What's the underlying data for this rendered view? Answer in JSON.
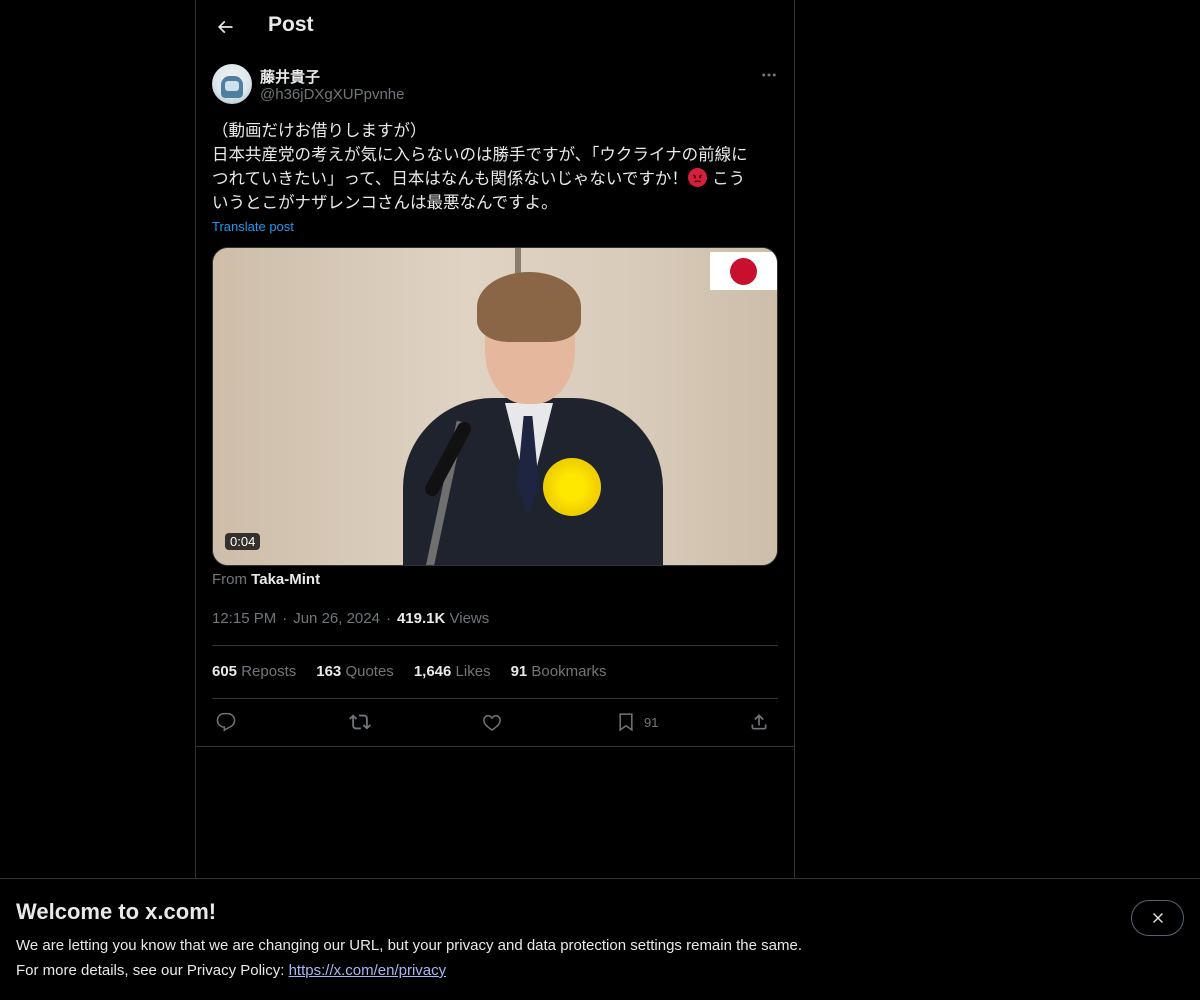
{
  "header": {
    "title": "Post"
  },
  "author": {
    "display_name": "藤井貴子",
    "handle": "@h36jDXgXUPpvnhe"
  },
  "post": {
    "line1": "（動画だけお借りしますが）",
    "line2": "日本共産党の考えが気に入らないのは勝手ですが、「ウクライナの前線に",
    "line3a": "つれていきたい」って、日本はなんも関係ないじゃないですか！",
    "line3b": " こう",
    "line4": "いうとこがナザレンコさんは最悪なんですよ。",
    "translate_label": "Translate post"
  },
  "media": {
    "duration": "0:04",
    "from_label": "From",
    "from_user": "Taka-Mint"
  },
  "meta": {
    "time": "12:15 PM",
    "date": "Jun 26, 2024",
    "views_count": "419.1K",
    "views_label": "Views"
  },
  "stats": {
    "reposts_count": "605",
    "reposts_label": "Reposts",
    "quotes_count": "163",
    "quotes_label": "Quotes",
    "likes_count": "1,646",
    "likes_label": "Likes",
    "bookmarks_count": "91",
    "bookmarks_label": "Bookmarks"
  },
  "actions": {
    "bookmark_count": "91"
  },
  "banner": {
    "title": "Welcome to x.com!",
    "text1": "We are letting you know that we are changing our URL, but your privacy and data protection settings remain the same.",
    "text2": "For more details, see our Privacy Policy: ",
    "link": "https://x.com/en/privacy"
  },
  "colors": {
    "background": "#000000",
    "text": "#e7e9ea",
    "muted": "#71767b",
    "link": "#1d9bf0",
    "border": "#2f3336"
  },
  "icons": [
    "back-arrow-icon",
    "more-icon",
    "reply-icon",
    "repost-icon",
    "like-icon",
    "bookmark-icon",
    "share-icon",
    "close-icon"
  ]
}
